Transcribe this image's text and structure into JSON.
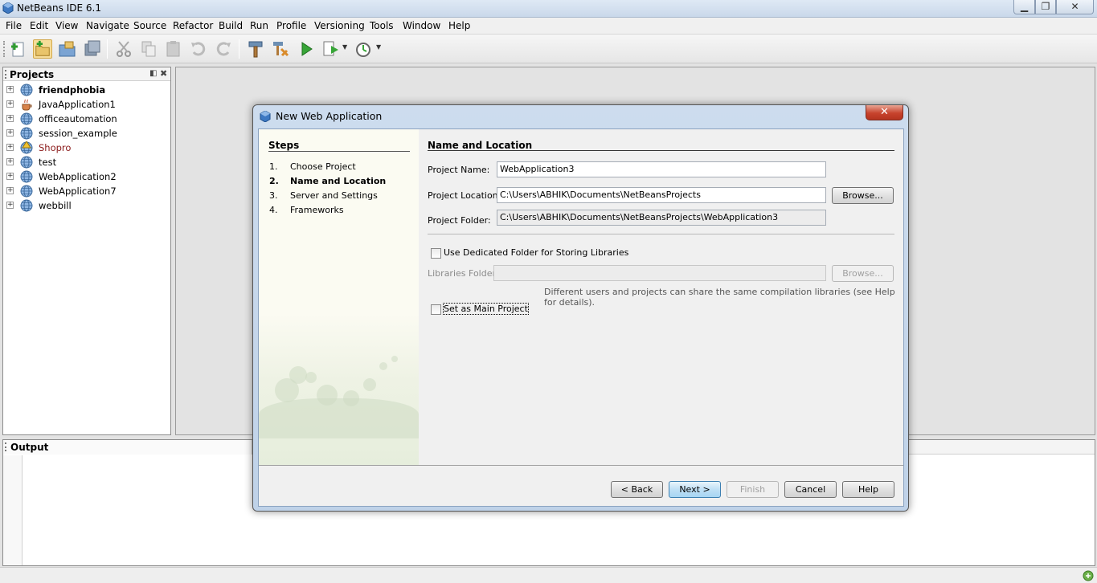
{
  "window": {
    "title": "NetBeans IDE 6.1"
  },
  "menu": [
    "File",
    "Edit",
    "View",
    "Navigate",
    "Source",
    "Refactor",
    "Build",
    "Run",
    "Profile",
    "Versioning",
    "Tools",
    "Window",
    "Help"
  ],
  "toolbar": {
    "icons": [
      "new-file-icon",
      "new-project-icon",
      "open-project-icon",
      "save-all-icon",
      "cut-icon",
      "copy-icon",
      "paste-icon",
      "undo-icon",
      "redo-icon",
      "build-icon",
      "clean-build-icon",
      "run-icon",
      "debug-icon",
      "profile-icon"
    ]
  },
  "projects": {
    "title": "Projects",
    "items": [
      {
        "label": "friendphobia",
        "bold": true,
        "color": "#000000",
        "icon": "web-project-icon"
      },
      {
        "label": "JavaApplication1",
        "bold": false,
        "color": "#000000",
        "icon": "java-project-icon"
      },
      {
        "label": "officeautomation",
        "bold": false,
        "color": "#000000",
        "icon": "web-project-icon"
      },
      {
        "label": "session_example",
        "bold": false,
        "color": "#000000",
        "icon": "web-project-icon"
      },
      {
        "label": "Shopro",
        "bold": false,
        "color": "#8b1a1a",
        "icon": "web-project-warning-icon"
      },
      {
        "label": "test",
        "bold": false,
        "color": "#000000",
        "icon": "web-project-icon"
      },
      {
        "label": "WebApplication2",
        "bold": false,
        "color": "#000000",
        "icon": "web-project-icon"
      },
      {
        "label": "WebApplication7",
        "bold": false,
        "color": "#000000",
        "icon": "web-project-icon"
      },
      {
        "label": "webbill",
        "bold": false,
        "color": "#000000",
        "icon": "web-project-icon"
      }
    ]
  },
  "output": {
    "title": "Output"
  },
  "dialog": {
    "title": "New Web Application",
    "close_label": "✕",
    "steps_title": "Steps",
    "steps": [
      {
        "num": "1.",
        "label": "Choose Project",
        "current": false
      },
      {
        "num": "2.",
        "label": "Name and Location",
        "current": true
      },
      {
        "num": "3.",
        "label": "Server and Settings",
        "current": false
      },
      {
        "num": "4.",
        "label": "Frameworks",
        "current": false
      }
    ],
    "section_title": "Name and Location",
    "project_name_label": "Project Name:",
    "project_name_value": "WebApplication3",
    "project_location_label": "Project Location:",
    "project_location_value": "C:\\Users\\ABHIK\\Documents\\NetBeansProjects",
    "browse_label": "Browse...",
    "project_folder_label": "Project Folder:",
    "project_folder_value": "C:\\Users\\ABHIK\\Documents\\NetBeansProjects\\WebApplication3",
    "dedicated_folder_label": "Use Dedicated Folder for Storing Libraries",
    "dedicated_folder_checked": false,
    "libraries_folder_label": "Libraries Folder:",
    "libraries_folder_value": "",
    "libraries_browse_label": "Browse...",
    "libraries_hint": "Different users and projects can share the same compilation libraries (see Help for details).",
    "main_project_label": "Set as Main Project",
    "main_project_checked": false,
    "buttons": {
      "back": "< Back",
      "next": "Next >",
      "finish": "Finish",
      "cancel": "Cancel",
      "help": "Help"
    }
  }
}
